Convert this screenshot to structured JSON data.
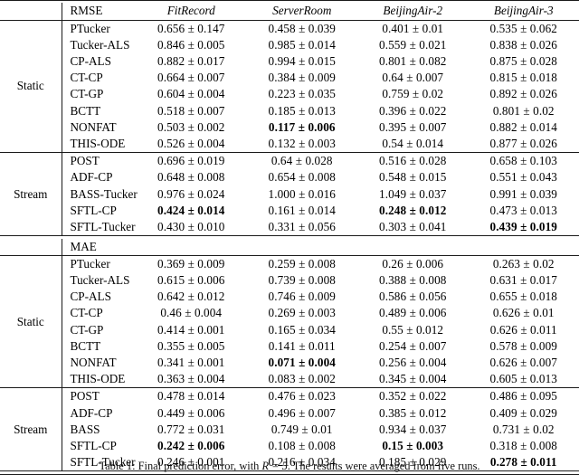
{
  "table": {
    "column_headers": [
      "",
      "",
      "FitRecord",
      "ServerRoom",
      "BeijingAir-2",
      "BeijingAir-3"
    ],
    "datasets": [
      "FitRecord",
      "ServerRoom",
      "BeijingAir-2",
      "BeijingAir-3"
    ],
    "metric_rmse_label": "RMSE",
    "metric_mae_label": "MAE",
    "group_static_label": "Static",
    "group_stream_label": "Stream",
    "sections": [
      {
        "metric": "RMSE",
        "groups": [
          {
            "name": "Static",
            "rows": [
              {
                "method": "PTucker",
                "values": [
                  "0.656 ± 0.147",
                  "0.458 ± 0.039",
                  "0.401 ± 0.01",
                  "0.535 ± 0.062"
                ],
                "bold": [
                  false,
                  false,
                  false,
                  false
                ]
              },
              {
                "method": "Tucker-ALS",
                "values": [
                  "0.846 ± 0.005",
                  "0.985 ± 0.014",
                  "0.559 ± 0.021",
                  "0.838 ± 0.026"
                ],
                "bold": [
                  false,
                  false,
                  false,
                  false
                ]
              },
              {
                "method": "CP-ALS",
                "values": [
                  "0.882 ± 0.017",
                  "0.994 ± 0.015",
                  "0.801 ± 0.082",
                  "0.875 ± 0.028"
                ],
                "bold": [
                  false,
                  false,
                  false,
                  false
                ]
              },
              {
                "method": "CT-CP",
                "values": [
                  "0.664 ± 0.007",
                  "0.384 ± 0.009",
                  "0.64 ± 0.007",
                  "0.815 ± 0.018"
                ],
                "bold": [
                  false,
                  false,
                  false,
                  false
                ]
              },
              {
                "method": "CT-GP",
                "values": [
                  "0.604 ± 0.004",
                  "0.223 ± 0.035",
                  "0.759 ± 0.02",
                  "0.892 ± 0.026"
                ],
                "bold": [
                  false,
                  false,
                  false,
                  false
                ]
              },
              {
                "method": "BCTT",
                "values": [
                  "0.518 ± 0.007",
                  "0.185 ± 0.013",
                  "0.396 ± 0.022",
                  "0.801 ± 0.02"
                ],
                "bold": [
                  false,
                  false,
                  false,
                  false
                ]
              },
              {
                "method": "NONFAT",
                "values": [
                  "0.503 ± 0.002",
                  "0.117 ± 0.006",
                  "0.395 ± 0.007",
                  "0.882 ± 0.014"
                ],
                "bold": [
                  false,
                  true,
                  false,
                  false
                ]
              },
              {
                "method": "THIS-ODE",
                "values": [
                  "0.526 ± 0.004",
                  "0.132 ± 0.003",
                  "0.54 ± 0.014",
                  "0.877 ± 0.026"
                ],
                "bold": [
                  false,
                  false,
                  false,
                  false
                ]
              }
            ]
          },
          {
            "name": "Stream",
            "rows": [
              {
                "method": "POST",
                "values": [
                  "0.696 ± 0.019",
                  "0.64 ± 0.028",
                  "0.516 ± 0.028",
                  "0.658 ± 0.103"
                ],
                "bold": [
                  false,
                  false,
                  false,
                  false
                ]
              },
              {
                "method": "ADF-CP",
                "values": [
                  "0.648 ± 0.008",
                  "0.654 ± 0.008",
                  "0.548 ± 0.015",
                  "0.551 ± 0.043"
                ],
                "bold": [
                  false,
                  false,
                  false,
                  false
                ]
              },
              {
                "method": "BASS-Tucker",
                "values": [
                  "0.976 ± 0.024",
                  "1.000 ± 0.016",
                  "1.049 ± 0.037",
                  "0.991 ± 0.039"
                ],
                "bold": [
                  false,
                  false,
                  false,
                  false
                ]
              },
              {
                "method": "SFTL-CP",
                "values": [
                  "0.424 ± 0.014",
                  "0.161 ± 0.014",
                  "0.248 ± 0.012",
                  "0.473 ± 0.013"
                ],
                "bold": [
                  true,
                  false,
                  true,
                  false
                ]
              },
              {
                "method": "SFTL-Tucker",
                "values": [
                  "0.430 ± 0.010",
                  "0.331 ± 0.056",
                  "0.303 ± 0.041",
                  "0.439 ± 0.019"
                ],
                "bold": [
                  false,
                  false,
                  false,
                  true
                ]
              }
            ]
          }
        ]
      },
      {
        "metric": "MAE",
        "groups": [
          {
            "name": "Static",
            "rows": [
              {
                "method": "PTucker",
                "values": [
                  "0.369 ± 0.009",
                  "0.259 ± 0.008",
                  "0.26 ± 0.006",
                  "0.263 ± 0.02"
                ],
                "bold": [
                  false,
                  false,
                  false,
                  false
                ]
              },
              {
                "method": "Tucker-ALS",
                "values": [
                  "0.615 ± 0.006",
                  "0.739 ± 0.008",
                  "0.388 ± 0.008",
                  "0.631 ± 0.017"
                ],
                "bold": [
                  false,
                  false,
                  false,
                  false
                ]
              },
              {
                "method": "CP-ALS",
                "values": [
                  "0.642 ± 0.012",
                  "0.746 ± 0.009",
                  "0.586 ± 0.056",
                  "0.655 ± 0.018"
                ],
                "bold": [
                  false,
                  false,
                  false,
                  false
                ]
              },
              {
                "method": "CT-CP",
                "values": [
                  "0.46 ± 0.004",
                  "0.269 ± 0.003",
                  "0.489 ± 0.006",
                  "0.626 ± 0.01"
                ],
                "bold": [
                  false,
                  false,
                  false,
                  false
                ]
              },
              {
                "method": "CT-GP",
                "values": [
                  "0.414 ± 0.001",
                  "0.165 ± 0.034",
                  "0.55 ± 0.012",
                  "0.626 ± 0.011"
                ],
                "bold": [
                  false,
                  false,
                  false,
                  false
                ]
              },
              {
                "method": "BCTT",
                "values": [
                  "0.355 ± 0.005",
                  "0.141 ± 0.011",
                  "0.254 ± 0.007",
                  "0.578 ± 0.009"
                ],
                "bold": [
                  false,
                  false,
                  false,
                  false
                ]
              },
              {
                "method": "NONFAT",
                "values": [
                  "0.341 ± 0.001",
                  "0.071 ± 0.004",
                  "0.256 ± 0.004",
                  "0.626 ± 0.007"
                ],
                "bold": [
                  false,
                  true,
                  false,
                  false
                ]
              },
              {
                "method": "THIS-ODE",
                "values": [
                  "0.363 ± 0.004",
                  "0.083 ± 0.002",
                  "0.345 ± 0.004",
                  "0.605 ± 0.013"
                ],
                "bold": [
                  false,
                  false,
                  false,
                  false
                ]
              }
            ]
          },
          {
            "name": "Stream",
            "rows": [
              {
                "method": "POST",
                "values": [
                  "0.478 ± 0.014",
                  "0.476 ± 0.023",
                  "0.352 ± 0.022",
                  "0.486 ± 0.095"
                ],
                "bold": [
                  false,
                  false,
                  false,
                  false
                ]
              },
              {
                "method": "ADF-CP",
                "values": [
                  "0.449 ± 0.006",
                  "0.496 ± 0.007",
                  "0.385 ± 0.012",
                  "0.409 ± 0.029"
                ],
                "bold": [
                  false,
                  false,
                  false,
                  false
                ]
              },
              {
                "method": "BASS",
                "values": [
                  "0.772 ± 0.031",
                  "0.749 ± 0.01",
                  "0.934 ± 0.037",
                  "0.731 ± 0.02"
                ],
                "bold": [
                  false,
                  false,
                  false,
                  false
                ]
              },
              {
                "method": "SFTL-CP",
                "values": [
                  "0.242 ± 0.006",
                  "0.108 ± 0.008",
                  "0.15 ± 0.003",
                  "0.318 ± 0.008"
                ],
                "bold": [
                  true,
                  false,
                  true,
                  false
                ]
              },
              {
                "method": "SFTL-Tucker",
                "values": [
                  "0.246 ± 0.001",
                  "0.216 ± 0.034",
                  "0.185 ± 0.029",
                  "0.278 ± 0.011"
                ],
                "bold": [
                  false,
                  false,
                  false,
                  true
                ]
              }
            ]
          }
        ]
      }
    ]
  },
  "caption": {
    "prefix": "Table 1: Final prediction error, with ",
    "math": "R = 5",
    "suffix": ". The results were averaged from five runs."
  }
}
